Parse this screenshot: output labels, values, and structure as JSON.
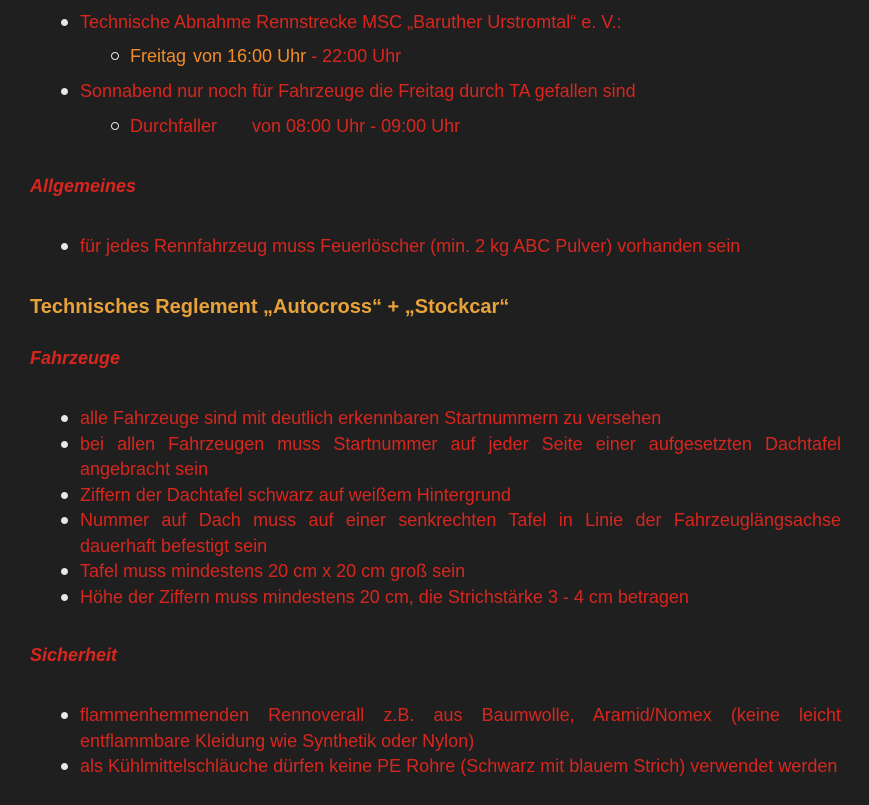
{
  "sections": {
    "ta": {
      "item1": "Technische Abnahme Rennstrecke MSC „Baruther Urstromtal“ e. V.:",
      "sub1": {
        "label": "Freitag",
        "time_start": "von 16:00 Uhr",
        "time_end": " - 22:00 Uhr"
      },
      "item2": "Sonnabend nur noch für Fahrzeuge die Freitag durch TA gefallen sind",
      "sub2": {
        "label": "Durchfaller",
        "time": "von 08:00 Uhr - 09:00 Uhr"
      }
    },
    "allgemeines": {
      "heading": "Allgemeines",
      "items": [
        "für jedes Rennfahrzeug muss Feuerlöscher (min. 2 kg ABC Pulver) vorhanden sein"
      ]
    },
    "reglement": {
      "title": "Technisches Reglement „Autocross“ + „Stockcar“"
    },
    "fahrzeuge": {
      "heading": "Fahrzeuge",
      "items": [
        "alle Fahrzeuge sind mit deutlich erkennbaren Startnummern zu versehen",
        "bei allen Fahrzeugen muss Startnummer auf jeder Seite einer aufgesetzten Dachtafel angebracht sein",
        "Ziffern der Dachtafel schwarz auf weißem Hintergrund",
        "Nummer auf Dach muss auf einer senkrechten Tafel in Linie der Fahrzeuglängsachse dauerhaft befestigt sein",
        "Tafel muss mindestens 20 cm x 20 cm groß sein",
        "Höhe der Ziffern muss mindestens 20 cm, die Strichstärke 3 - 4 cm betragen"
      ]
    },
    "sicherheit": {
      "heading": "Sicherheit",
      "items": [
        "flammenhemmenden Rennoverall z.B. aus Baumwolle, Aramid/Nomex (keine leicht entflammbare Kleidung wie Synthetik oder Nylon)",
        "als Kühlmittelschläuche dürfen keine PE Rohre (Schwarz mit blauem Strich) verwendet werden"
      ]
    }
  },
  "colors": {
    "background": "#1f1f1f",
    "text_red": "#d7261e",
    "text_orange": "#f28c28",
    "heading_gold": "#e8a23a",
    "bullet": "#e6e6e6"
  }
}
